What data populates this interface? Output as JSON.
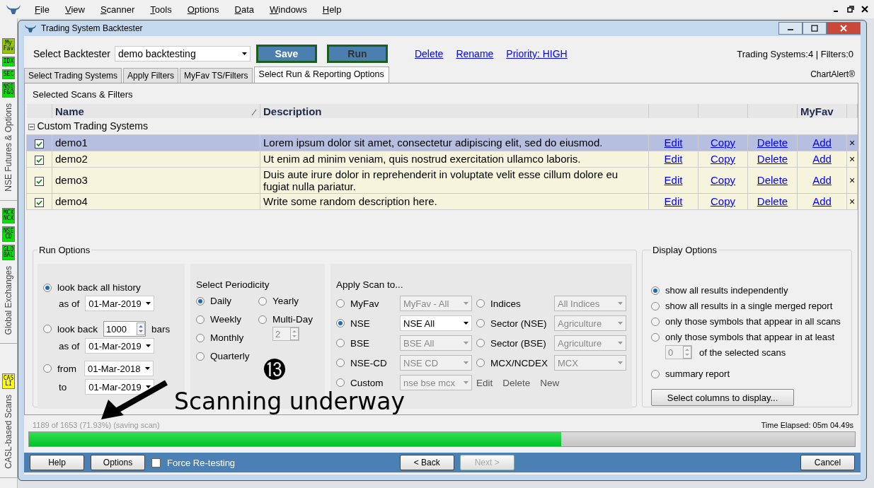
{
  "menu": [
    "File",
    "View",
    "Scanner",
    "Tools",
    "Options",
    "Data",
    "Windows",
    "Help"
  ],
  "sidebar": [
    {
      "badges": [
        {
          "text": "My Fav",
          "color": "#94c800"
        },
        {
          "text": "IDX",
          "color": "#00e400"
        },
        {
          "text": "SEC",
          "color": "#00e400"
        },
        {
          "text": "NSE F&O",
          "color": "#00e400"
        }
      ],
      "label": "NSE Futures & Options"
    },
    {
      "badges": [
        {
          "text": "MCX NCX",
          "color": "#00e400"
        },
        {
          "text": "NSE CD",
          "color": "#00e400"
        },
        {
          "text": "GLO BAL",
          "color": "#00e400"
        }
      ],
      "label": "Global Exchanges"
    },
    {
      "badges": [
        {
          "text": "CAS LI",
          "color": "#ffff00"
        }
      ],
      "label": "CASL-based Scans"
    }
  ],
  "window": {
    "title": "Trading System Backtester"
  },
  "toolbar": {
    "label": "Select Backtester",
    "backtester": "demo backtesting",
    "save": "Save",
    "run": "Run",
    "links": [
      "Delete",
      "Rename",
      "Priority: HIGH"
    ],
    "summary": "Trading Systems:4 | Filters:0",
    "brand": "ChartAlert®"
  },
  "tabs": [
    {
      "label": "Select Trading Systems",
      "selected": false
    },
    {
      "label": "Apply Filters",
      "selected": false
    },
    {
      "label": "MyFav TS/Filters",
      "selected": false
    },
    {
      "label": "Select Run & Reporting Options",
      "selected": true
    }
  ],
  "section_title": "Selected Scans & Filters",
  "table": {
    "columns": {
      "name": "Name",
      "description": "Description",
      "myfav": "MyFav"
    },
    "group": {
      "label": "Custom Trading Systems",
      "expanded": true
    },
    "rows": [
      {
        "checked": true,
        "selected": true,
        "name": "demo1",
        "description": "Lorem ipsum dolor sit amet, consectetur adipiscing elit, sed do eiusmod.",
        "actions": [
          "Edit",
          "Copy",
          "Delete",
          "Add"
        ],
        "remove": "×"
      },
      {
        "checked": true,
        "selected": false,
        "name": "demo2",
        "description": "Ut enim ad minim veniam, quis nostrud exercitation ullamco laboris.",
        "actions": [
          "Edit",
          "Copy",
          "Delete",
          "Add"
        ],
        "remove": "×"
      },
      {
        "checked": true,
        "selected": false,
        "name": "demo3",
        "description": "Duis aute irure dolor in reprehenderit in voluptate velit esse cillum dolore eu fugiat nulla pariatur.",
        "actions": [
          "Edit",
          "Copy",
          "Delete",
          "Add"
        ],
        "remove": "×"
      },
      {
        "checked": true,
        "selected": false,
        "name": "demo4",
        "description": "Write some random description here.",
        "actions": [
          "Edit",
          "Copy",
          "Delete",
          "Add"
        ],
        "remove": "×"
      }
    ]
  },
  "run_options": {
    "title": "Run Options",
    "all_history": {
      "label": "look back all history",
      "selected": true,
      "as_of_label": "as of",
      "as_of": "01-Mar-2019"
    },
    "bars": {
      "label": "look back",
      "selected": false,
      "count": "1000",
      "unit": "bars",
      "as_of_label": "as of",
      "as_of": "01-Mar-2019"
    },
    "range": {
      "label": "from",
      "selected": false,
      "from": "01-Mar-2018",
      "to_label": "to",
      "to": "01-Mar-2019"
    }
  },
  "periodicity": {
    "title": "Select Periodicity",
    "options": [
      {
        "label": "Daily",
        "selected": true
      },
      {
        "label": "Yearly",
        "selected": false
      },
      {
        "label": "Weekly",
        "selected": false
      },
      {
        "label": "Multi-Day",
        "selected": false
      },
      {
        "label": "Monthly",
        "selected": false
      },
      {
        "label": "Quarterly",
        "selected": false
      }
    ],
    "multi_day": {
      "value": "2",
      "disabled": true
    }
  },
  "apply_scan": {
    "title": "Apply Scan to...",
    "left": [
      {
        "label": "MyFav",
        "selected": false,
        "value": "MyFav - All",
        "disabled": true
      },
      {
        "label": "NSE",
        "selected": true,
        "value": "NSE All",
        "disabled": false
      },
      {
        "label": "BSE",
        "selected": false,
        "value": "BSE All",
        "disabled": true
      },
      {
        "label": "NSE-CD",
        "selected": false,
        "value": "NSE CD",
        "disabled": true
      },
      {
        "label": "Custom",
        "selected": false,
        "value": "nse bse mcx",
        "disabled": true
      }
    ],
    "right": [
      {
        "label": "Indices",
        "selected": false,
        "value": "All Indices",
        "disabled": true
      },
      {
        "label": "Sector (NSE)",
        "selected": false,
        "value": "Agriculture",
        "disabled": true
      },
      {
        "label": "Sector (BSE)",
        "selected": false,
        "value": "Agriculture",
        "disabled": true
      },
      {
        "label": "MCX/NCDEX",
        "selected": false,
        "value": "MCX",
        "disabled": true
      }
    ],
    "custom_actions": [
      "Edit",
      "Delete",
      "New"
    ]
  },
  "display_options": {
    "title": "Display Options",
    "options": [
      {
        "label": "show all results independently",
        "selected": true
      },
      {
        "label": "show all results in a single merged report",
        "selected": false
      },
      {
        "label": "only those symbols that appear in all scans",
        "selected": false
      },
      {
        "label": "only those symbols that appear in at least",
        "selected": false,
        "count": "0",
        "suffix": "of the selected scans"
      },
      {
        "label": "summary report",
        "selected": false
      }
    ],
    "button": "Select columns to display..."
  },
  "status": {
    "progress_text": "1189 of 1653 (71.93%) (saving scan)",
    "elapsed": "Time Elapsed: 05m 04.49s",
    "level": 0.644
  },
  "footer": {
    "help": "Help",
    "options": "Options",
    "force": {
      "label": "Force Re-testing",
      "checked": false
    },
    "back": "< Back",
    "next": {
      "label": "Next >",
      "disabled": true
    },
    "cancel": "Cancel"
  },
  "annotation": {
    "badge": "⓭",
    "caption": "Scanning underway"
  }
}
